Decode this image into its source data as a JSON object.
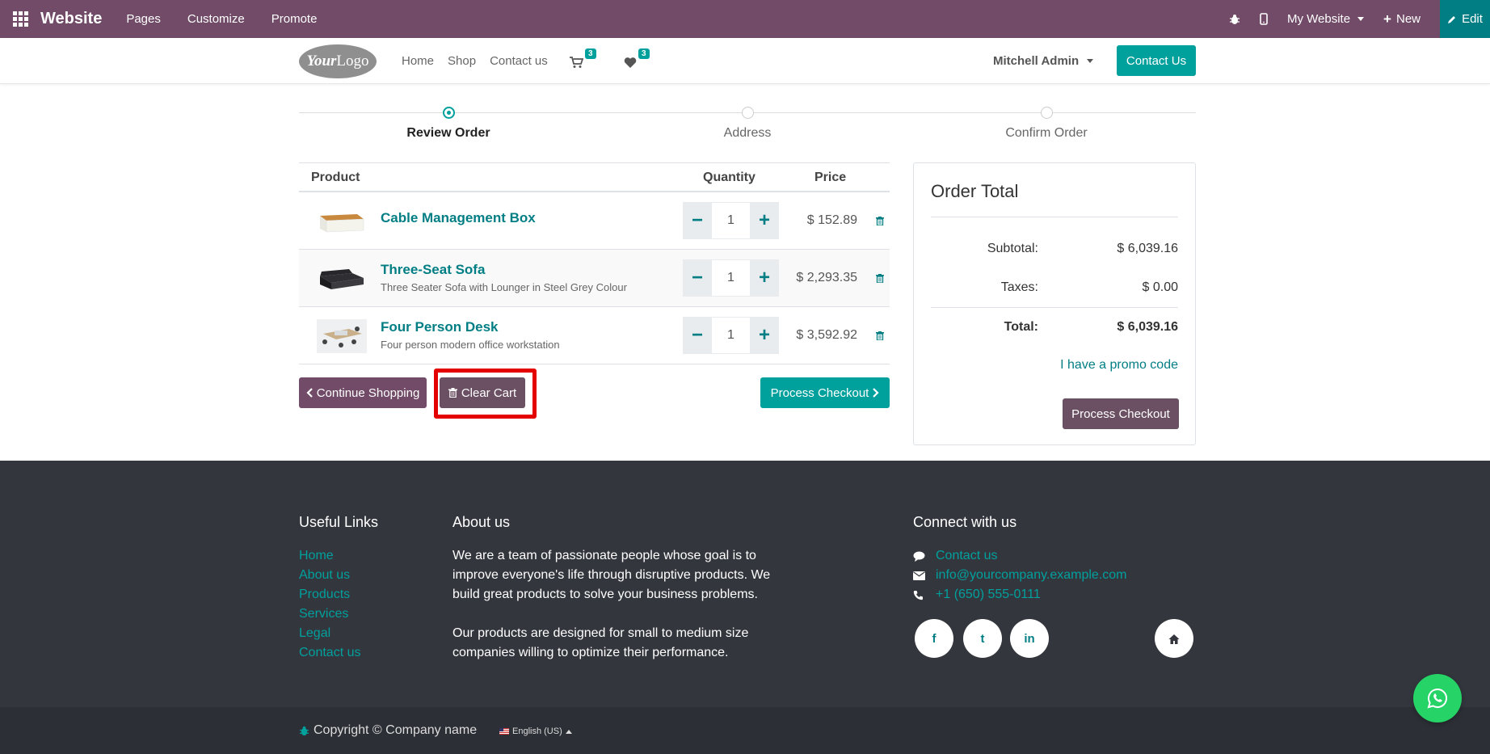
{
  "topbar": {
    "brand": "Website",
    "menu": [
      "Pages",
      "Customize",
      "Promote"
    ],
    "website_selector": "My Website",
    "new_label": "New",
    "edit_label": "Edit"
  },
  "header": {
    "logo_text_bold": "Your",
    "logo_text": "Logo",
    "nav": [
      "Home",
      "Shop",
      "Contact us"
    ],
    "cart_count": "3",
    "wishlist_count": "3",
    "user_name": "Mitchell Admin",
    "contact_button": "Contact Us"
  },
  "steps": {
    "items": [
      "Review Order",
      "Address",
      "Confirm Order"
    ],
    "active": 0
  },
  "cart": {
    "headers": {
      "product": "Product",
      "quantity": "Quantity",
      "price": "Price"
    },
    "lines": [
      {
        "name": "Cable Management Box",
        "description": "",
        "quantity": "1",
        "price": "$ 152.89"
      },
      {
        "name": "Three-Seat Sofa",
        "description": "Three Seater Sofa with Lounger in Steel Grey Colour",
        "quantity": "1",
        "price": "$ 2,293.35"
      },
      {
        "name": "Four Person Desk",
        "description": "Four person modern office workstation",
        "quantity": "1",
        "price": "$ 3,592.92"
      }
    ],
    "continue_label": "Continue Shopping",
    "clear_label": "Clear Cart",
    "checkout_label": "Process Checkout"
  },
  "order_total": {
    "title": "Order Total",
    "subtotal_label": "Subtotal:",
    "subtotal": "$ 6,039.16",
    "taxes_label": "Taxes:",
    "taxes": "$ 0.00",
    "total_label": "Total:",
    "total": "$ 6,039.16",
    "promo_label": "I have a promo code",
    "checkout_label": "Process Checkout"
  },
  "footer": {
    "links_title": "Useful Links",
    "links": [
      "Home",
      "About us",
      "Products",
      "Services",
      "Legal",
      "Contact us"
    ],
    "about_title": "About us",
    "about_p1": "We are a team of passionate people whose goal is to improve everyone's life through disruptive products. We build great products to solve your business problems.",
    "about_p2": "Our products are designed for small to medium size companies willing to optimize their performance.",
    "connect_title": "Connect with us",
    "contact_link": "Contact us",
    "email": "info@yourcompany.example.com",
    "phone": "+1 (650) 555-0111",
    "social": [
      "f",
      "t",
      "in"
    ]
  },
  "copyright": {
    "text": "Copyright © Company name",
    "language": "English (US)"
  },
  "colors": {
    "brand": "#714b67",
    "accent": "#00a09d",
    "link": "#017e84",
    "highlight": "#e50000"
  }
}
